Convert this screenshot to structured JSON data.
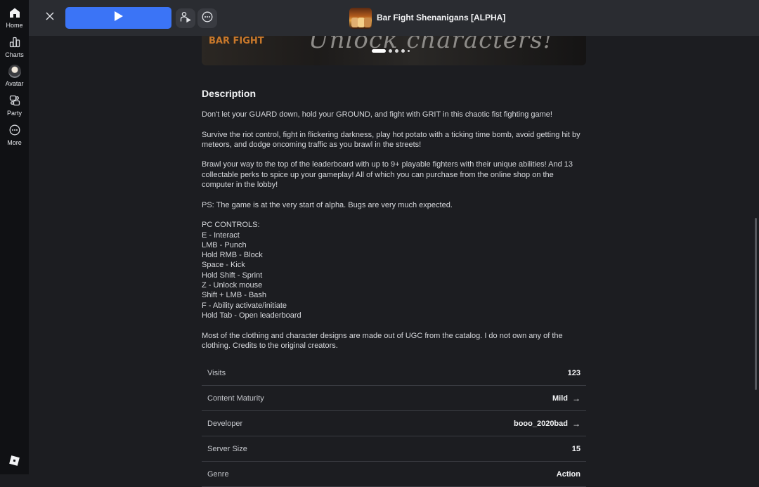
{
  "nav": {
    "items": [
      {
        "label": "Home",
        "icon": "home-icon"
      },
      {
        "label": "Charts",
        "icon": "charts-icon"
      },
      {
        "label": "Avatar",
        "icon": "avatar-icon"
      },
      {
        "label": "Party",
        "icon": "party-icon"
      },
      {
        "label": "More",
        "icon": "more-icon"
      }
    ]
  },
  "header": {
    "game_title": "Bar Fight Shenanigans [ALPHA]"
  },
  "carousel": {
    "banner_text": "Unlock characters!",
    "logo_text": "BAR FIGHT",
    "slide_count": 5,
    "active_slide": 1
  },
  "description": {
    "title": "Description",
    "para1": "Don't let your GUARD down, hold your GROUND, and fight with GRIT in this chaotic fist fighting game!",
    "para2": "Survive the riot control, fight in flickering darkness, play hot potato with a ticking time bomb, avoid getting hit by meteors, and dodge oncoming traffic as you brawl in the streets!",
    "para3": "Brawl your way to the top of the leaderboard with up to 9+ playable fighters with their unique abilities! And 13 collectable perks to spice up your gameplay! All of which you can purchase from the online shop on the computer in the lobby!",
    "para4": "PS: The game is at the very start of alpha. Bugs are very much expected.",
    "controls_title": "PC CONTROLS:",
    "controls": [
      "E - Interact",
      "LMB - Punch",
      "Hold RMB - Block",
      "Space - Kick",
      "Hold Shift - Sprint",
      "Z - Unlock mouse",
      "Shift + LMB - Bash",
      "F - Ability activate/initiate",
      "Hold Tab - Open leaderboard"
    ],
    "para5": "Most of the clothing and character designs are made out of UGC from the catalog. I do not own any of the clothing. Credits to the original creators."
  },
  "stats": [
    {
      "label": "Visits",
      "value": "123",
      "link": false
    },
    {
      "label": "Content Maturity",
      "value": "Mild",
      "link": true
    },
    {
      "label": "Developer",
      "value": "booo_2020bad",
      "link": true
    },
    {
      "label": "Server Size",
      "value": "15",
      "link": false
    },
    {
      "label": "Genre",
      "value": "Action",
      "link": false
    }
  ],
  "colors": {
    "accent": "#3b74f6",
    "background": "#1c1d21",
    "topbar": "#2a2c31",
    "rail": "#101114"
  }
}
